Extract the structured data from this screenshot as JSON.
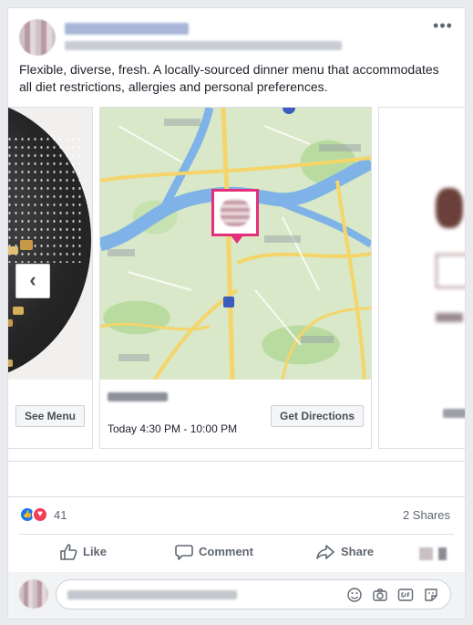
{
  "post": {
    "text": "Flexible, diverse, fresh. A locally-sourced dinner menu that accommodates all diet restrictions, allergies and personal preferences.",
    "more_icon": "•••"
  },
  "carousel": {
    "prev_icon": "‹",
    "cards": [
      {
        "button_label": "See Menu"
      },
      {
        "hours": "Today 4:30 PM - 10:00 PM",
        "button_label": "Get Directions"
      }
    ]
  },
  "stats": {
    "reaction_count": "41",
    "shares": "2 Shares",
    "like_icon": "👍",
    "love_icon": "♥"
  },
  "actions": {
    "like": "Like",
    "comment": "Comment",
    "share": "Share"
  },
  "colors": {
    "accent": "#1877f2",
    "map_pin": "#e4307a"
  }
}
